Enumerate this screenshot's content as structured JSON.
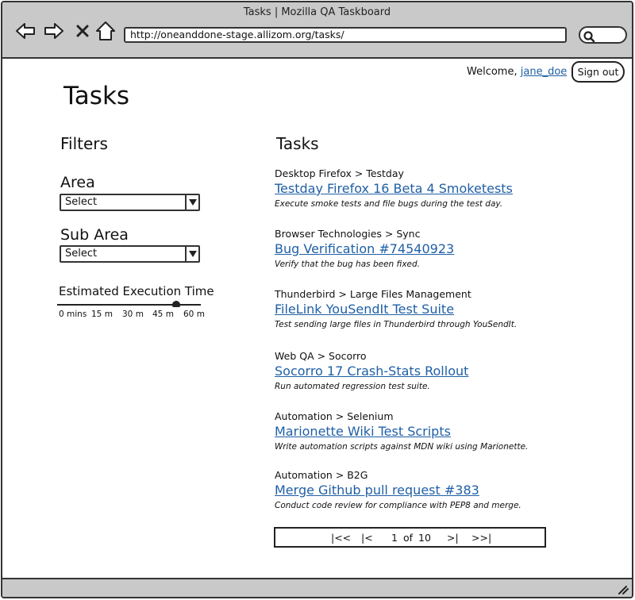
{
  "browser": {
    "window_title": "Tasks | Mozilla QA Taskboard",
    "url": "http://oneanddone-stage.allizom.org/tasks/",
    "nav_icons": [
      "back-icon",
      "forward-icon",
      "stop-icon",
      "home-icon"
    ],
    "search_icon": "search-icon"
  },
  "header": {
    "welcome_text": "Welcome,",
    "username": "jane_doe",
    "separator": "|",
    "signout_label": "Sign out"
  },
  "page": {
    "title": "Tasks"
  },
  "filters": {
    "heading": "Filters",
    "area": {
      "label": "Area",
      "value": "Select"
    },
    "subarea": {
      "label": "Sub Area",
      "value": "Select"
    },
    "execution_time": {
      "label": "Estimated Execution Time",
      "ticks": [
        "0 mins",
        "15 m",
        "30 m",
        "45 m",
        "60 m"
      ],
      "value_minutes": 50
    }
  },
  "tasks": {
    "heading": "Tasks",
    "items": [
      {
        "crumb": "Desktop Firefox > Testday",
        "title": "Testday Firefox 16 Beta 4 Smoketests",
        "description": "Execute smoke tests and file bugs during the test day."
      },
      {
        "crumb": "Browser Technologies > Sync",
        "title": "Bug Verification #74540923",
        "description": "Verify that the bug has been fixed."
      },
      {
        "crumb": "Thunderbird > Large Files Management",
        "title": "FileLink YouSendIt Test Suite",
        "description": "Test sending large files in Thunderbird through YouSendIt."
      },
      {
        "crumb": "Web QA > Socorro",
        "title": "Socorro 17 Crash-Stats Rollout",
        "description": "Run automated regression test suite."
      },
      {
        "crumb": "Automation > Selenium",
        "title": "Marionette Wiki Test Scripts",
        "description": "Write automation scripts against MDN wiki using Marionette."
      },
      {
        "crumb": "Automation > B2G",
        "title": "Merge Github pull request #383",
        "description": "Conduct code review for compliance with PEP8 and merge."
      }
    ]
  },
  "pagination": {
    "first": "|<<",
    "prev": "|<",
    "current": "1",
    "of": "of",
    "total": "10",
    "next": ">|",
    "last": ">>|"
  },
  "colors": {
    "link": "#1f5fa6",
    "chrome": "#c9c9c9"
  }
}
